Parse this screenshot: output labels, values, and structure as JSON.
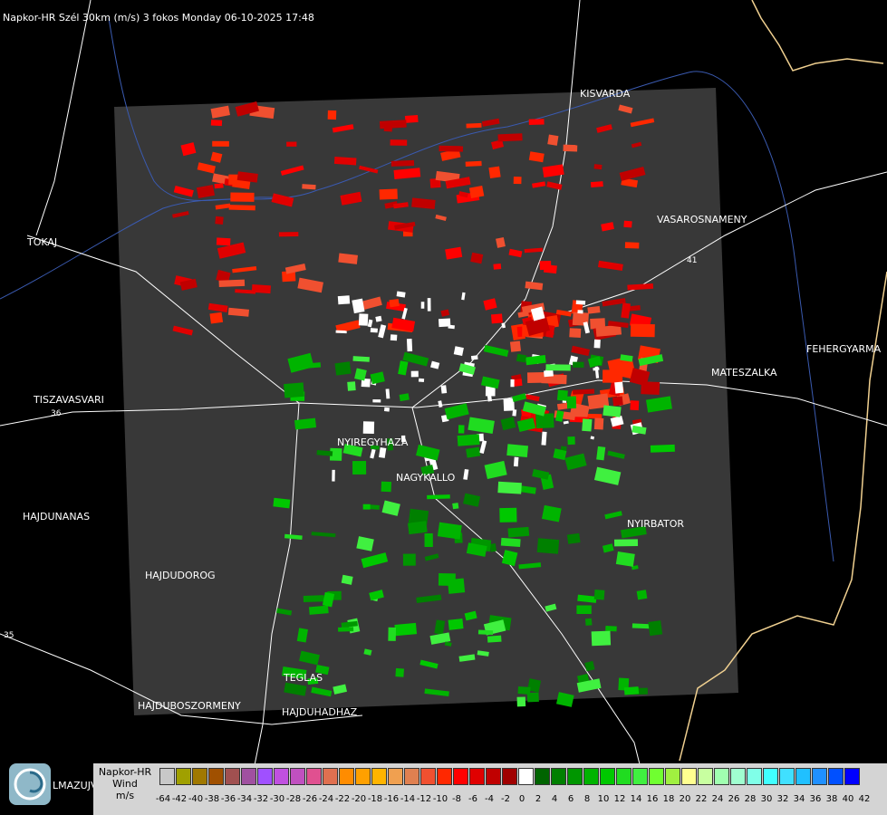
{
  "header": {
    "title": "Napkor-HR Szél 30km (m/s) 3 fokos Monday 06-10-2025 17:48"
  },
  "map": {
    "towns": [
      {
        "name": "KISVARDA"
      },
      {
        "name": "VASAROSNAMENY"
      },
      {
        "name": "TOKAJ"
      },
      {
        "name": "FEHERGYARMA"
      },
      {
        "name": "MATESZALKA"
      },
      {
        "name": "TISZAVASVARI"
      },
      {
        "name": "NYIREGYHAZA"
      },
      {
        "name": "NAGYKALLO"
      },
      {
        "name": "HAJDUNANAS"
      },
      {
        "name": "NYIRBATOR"
      },
      {
        "name": "HAJDUDOROG"
      },
      {
        "name": "TEGLAS"
      },
      {
        "name": "HAJDUBOSZORMENY"
      },
      {
        "name": "HAJDUHADHAZ"
      }
    ],
    "road_labels": [
      "35",
      "36",
      "41"
    ],
    "bottom_left_partial_label": "LMAZUJVAR"
  },
  "legend": {
    "label_lines": [
      "Napkor-HR",
      "Wind",
      "m/s"
    ],
    "colors": [
      "#c8c8c8",
      "#a0a000",
      "#a07800",
      "#a05000",
      "#a05050",
      "#a050a0",
      "#a050ff",
      "#c050e0",
      "#c050c0",
      "#e05090",
      "#e07050",
      "#ff8c00",
      "#ffa000",
      "#ffb400",
      "#f0a050",
      "#e08050",
      "#f05030",
      "#ff2800",
      "#ff0000",
      "#e00000",
      "#c00000",
      "#a00000",
      "#ffffff",
      "#006400",
      "#008000",
      "#009600",
      "#00b400",
      "#00c800",
      "#20dc20",
      "#40f040",
      "#70ff30",
      "#a0f040",
      "#ffff90",
      "#c8ffa0",
      "#a0ffb0",
      "#a0ffd0",
      "#80ffe8",
      "#40ffff",
      "#40e0ff",
      "#20c0ff",
      "#2090ff",
      "#0050ff",
      "#0000ff"
    ],
    "ticks": [
      "-64",
      "-42",
      "-40",
      "-38",
      "-36",
      "-34",
      "-32",
      "-30",
      "-28",
      "-26",
      "-24",
      "-22",
      "-20",
      "-18",
      "-16",
      "-14",
      "-12",
      "-10",
      "-8",
      "-6",
      "-4",
      "-2",
      "0",
      "2",
      "4",
      "6",
      "8",
      "10",
      "12",
      "14",
      "16",
      "18",
      "20",
      "22",
      "24",
      "26",
      "28",
      "30",
      "32",
      "34",
      "36",
      "38",
      "40",
      "42"
    ]
  }
}
